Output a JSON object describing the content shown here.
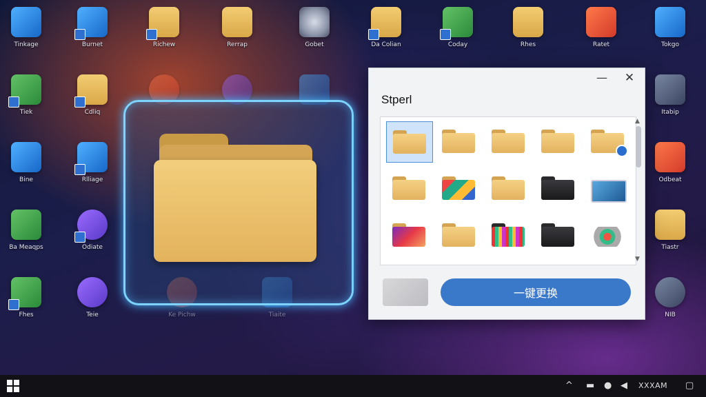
{
  "desktop": {
    "icons": [
      {
        "label": "Tinkage"
      },
      {
        "label": "Burnet"
      },
      {
        "label": "Richew"
      },
      {
        "label": "Rerrap"
      },
      {
        "label": "Gobet"
      },
      {
        "label": "Da Colian"
      },
      {
        "label": "Coday"
      },
      {
        "label": "Rhes"
      },
      {
        "label": "Ratet"
      },
      {
        "label": "Tokgo"
      },
      {
        "label": "Tiek"
      },
      {
        "label": "Cdliq"
      },
      {
        "label": "Itabip"
      },
      {
        "label": "Bine"
      },
      {
        "label": "Rlliage"
      },
      {
        "label": "Odbeat"
      },
      {
        "label": "Ba Meaqps"
      },
      {
        "label": "Odiate"
      },
      {
        "label": "Tiastr"
      },
      {
        "label": "Fhes"
      },
      {
        "label": "Teie"
      },
      {
        "label": "Ke Pichw"
      },
      {
        "label": "Tiaite"
      },
      {
        "label": "NIB"
      }
    ]
  },
  "dialog": {
    "title": "Stperl",
    "minimize_glyph": "—",
    "close_glyph": "✕",
    "replace_button": "一键更换",
    "scroll_up": "▲",
    "scroll_down": "▼"
  },
  "taskbar": {
    "tray_text": "XXXAM"
  },
  "colors": {
    "accent": "#3a78c9",
    "focus_glow": "#7cd4ff",
    "folder": "#e9bd67"
  }
}
